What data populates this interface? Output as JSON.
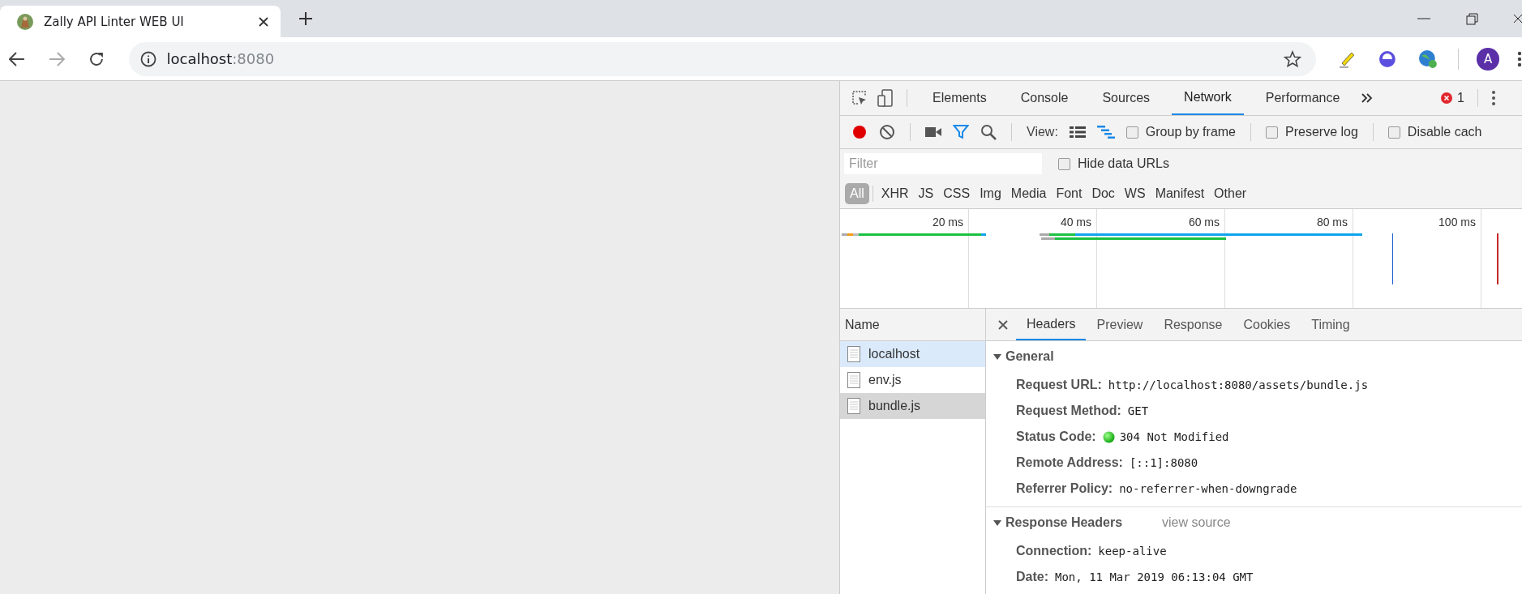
{
  "browser_tab": {
    "title": "Zally API Linter WEB UI"
  },
  "address": {
    "host": "localhost",
    "port": ":8080"
  },
  "avatar": "A",
  "devtools": {
    "tabs": [
      {
        "label": "Elements",
        "selected": false
      },
      {
        "label": "Console",
        "selected": false
      },
      {
        "label": "Sources",
        "selected": false
      },
      {
        "label": "Network",
        "selected": true
      },
      {
        "label": "Performance",
        "selected": false
      }
    ],
    "error_count": "1",
    "toolbar": {
      "recording": true,
      "view_label": "View:",
      "options": [
        {
          "label": "Group by frame",
          "checked": false
        },
        {
          "label": "Preserve log",
          "checked": false
        },
        {
          "label": "Disable cach",
          "checked": false
        }
      ]
    },
    "filter": {
      "placeholder": "Filter",
      "hide_data_urls": {
        "label": "Hide data URLs",
        "checked": false
      }
    },
    "types": [
      {
        "label": "All",
        "selected": true
      },
      {
        "label": "XHR",
        "selected": false
      },
      {
        "label": "JS",
        "selected": false
      },
      {
        "label": "CSS",
        "selected": false
      },
      {
        "label": "Img",
        "selected": false
      },
      {
        "label": "Media",
        "selected": false
      },
      {
        "label": "Font",
        "selected": false
      },
      {
        "label": "Doc",
        "selected": false
      },
      {
        "label": "WS",
        "selected": false
      },
      {
        "label": "Manifest",
        "selected": false
      },
      {
        "label": "Other",
        "selected": false
      }
    ],
    "timeline": {
      "ticks": [
        "20 ms",
        "40 ms",
        "60 ms",
        "80 ms",
        "100 ms"
      ]
    },
    "requests": {
      "header": "Name",
      "items": [
        {
          "name": "localhost",
          "selected": true,
          "hovered": false
        },
        {
          "name": "env.js",
          "selected": false,
          "hovered": false
        },
        {
          "name": "bundle.js",
          "selected": false,
          "hovered": true
        }
      ]
    },
    "detail_tabs": [
      {
        "label": "Headers",
        "selected": true
      },
      {
        "label": "Preview",
        "selected": false
      },
      {
        "label": "Response",
        "selected": false
      },
      {
        "label": "Cookies",
        "selected": false
      },
      {
        "label": "Timing",
        "selected": false
      }
    ],
    "sections": [
      {
        "title": "General",
        "expanded": true,
        "rows": [
          {
            "kind": "plain",
            "key": "Request URL:",
            "value": "http://localhost:8080/assets/bundle.js"
          },
          {
            "kind": "plain",
            "key": "Request Method:",
            "value": "GET"
          },
          {
            "kind": "status",
            "key": "Status Code:",
            "value": "304 Not Modified"
          },
          {
            "kind": "plain",
            "key": "Remote Address:",
            "value": "[::1]:8080"
          },
          {
            "kind": "plain",
            "key": "Referrer Policy:",
            "value": "no-referrer-when-downgrade"
          }
        ]
      },
      {
        "title": "Response Headers",
        "expanded": true,
        "action": "view source",
        "rows": [
          {
            "kind": "plain",
            "key": "Connection:",
            "value": "keep-alive"
          },
          {
            "kind": "plain",
            "key": "Date:",
            "value": "Mon, 11 Mar 2019 06:13:04 GMT"
          }
        ]
      }
    ]
  }
}
